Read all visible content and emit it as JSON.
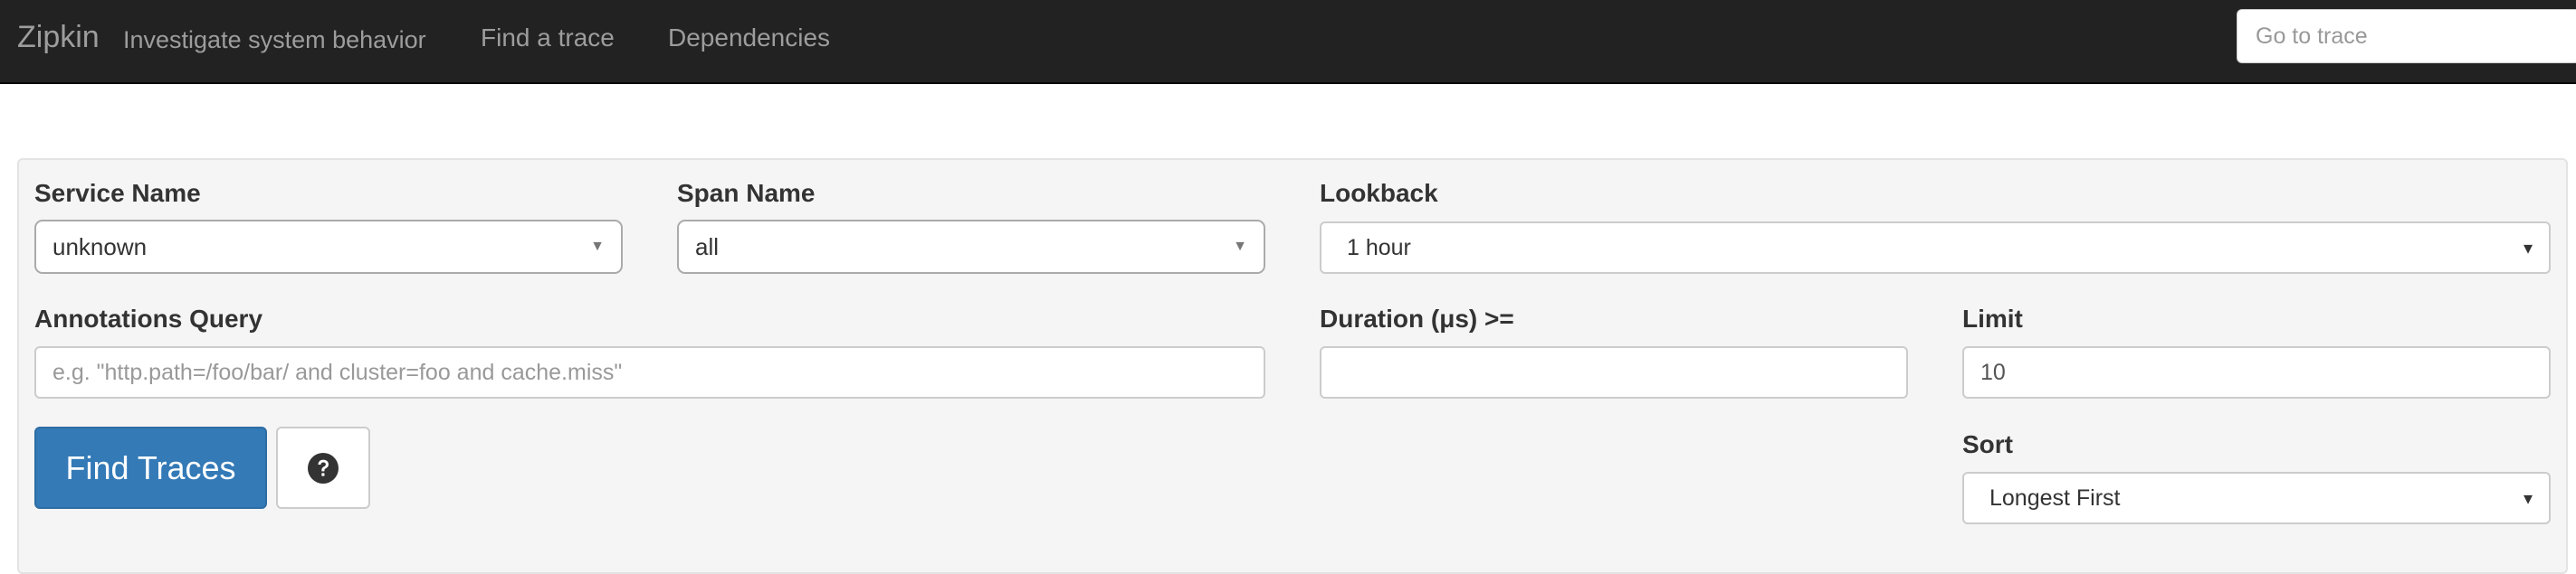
{
  "navbar": {
    "brand": "Zipkin",
    "tagline": "Investigate system behavior",
    "links": [
      {
        "label": "Find a trace"
      },
      {
        "label": "Dependencies"
      }
    ],
    "goto_trace": {
      "placeholder": "Go to trace",
      "value": ""
    }
  },
  "search": {
    "service_name": {
      "label": "Service Name",
      "value": "unknown"
    },
    "span_name": {
      "label": "Span Name",
      "value": "all"
    },
    "lookback": {
      "label": "Lookback",
      "value": "1 hour"
    },
    "annotations_query": {
      "label": "Annotations Query",
      "placeholder": "e.g. \"http.path=/foo/bar/ and cluster=foo and cache.miss\"",
      "value": ""
    },
    "duration": {
      "label": "Duration (μs) >=",
      "value": ""
    },
    "limit": {
      "label": "Limit",
      "value": "10"
    },
    "sort": {
      "label": "Sort",
      "value": "Longest First"
    },
    "find_button": {
      "label": "Find Traces"
    },
    "help_button": {
      "icon": "question-circle-icon"
    }
  },
  "colors": {
    "navbar_bg": "#222222",
    "nav_text": "#9d9d9d",
    "panel_bg": "#f5f5f5",
    "primary": "#337ab7"
  }
}
